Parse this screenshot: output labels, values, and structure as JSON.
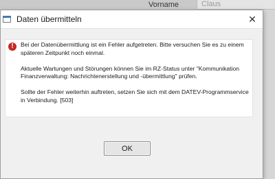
{
  "background": {
    "label": "Vorname",
    "field_value": "Claus"
  },
  "dialog": {
    "title": "Daten übermitteln",
    "close_glyph": "✕",
    "error_glyph": "!",
    "paragraphs": [
      "Bei der Datenübermittlung ist ein Fehler aufgetreten. Bitte versuchen Sie es zu einem späteren Zeitpunkt noch einmal.",
      "Aktuelle Wartungen und Störungen können Sie im RZ-Status unter \"Kommunikation Finanzverwaltung: Nachrichtenerstellung und -übermittlung\" prüfen.",
      "Sollte der Fehler weiterhin auftreten, setzen Sie sich mit dem DATEV-Programmservice in Verbindung. [503]"
    ],
    "ok_label": "OK"
  },
  "colors": {
    "error_red": "#c62828",
    "dialog_bg": "#f0f0f0"
  }
}
